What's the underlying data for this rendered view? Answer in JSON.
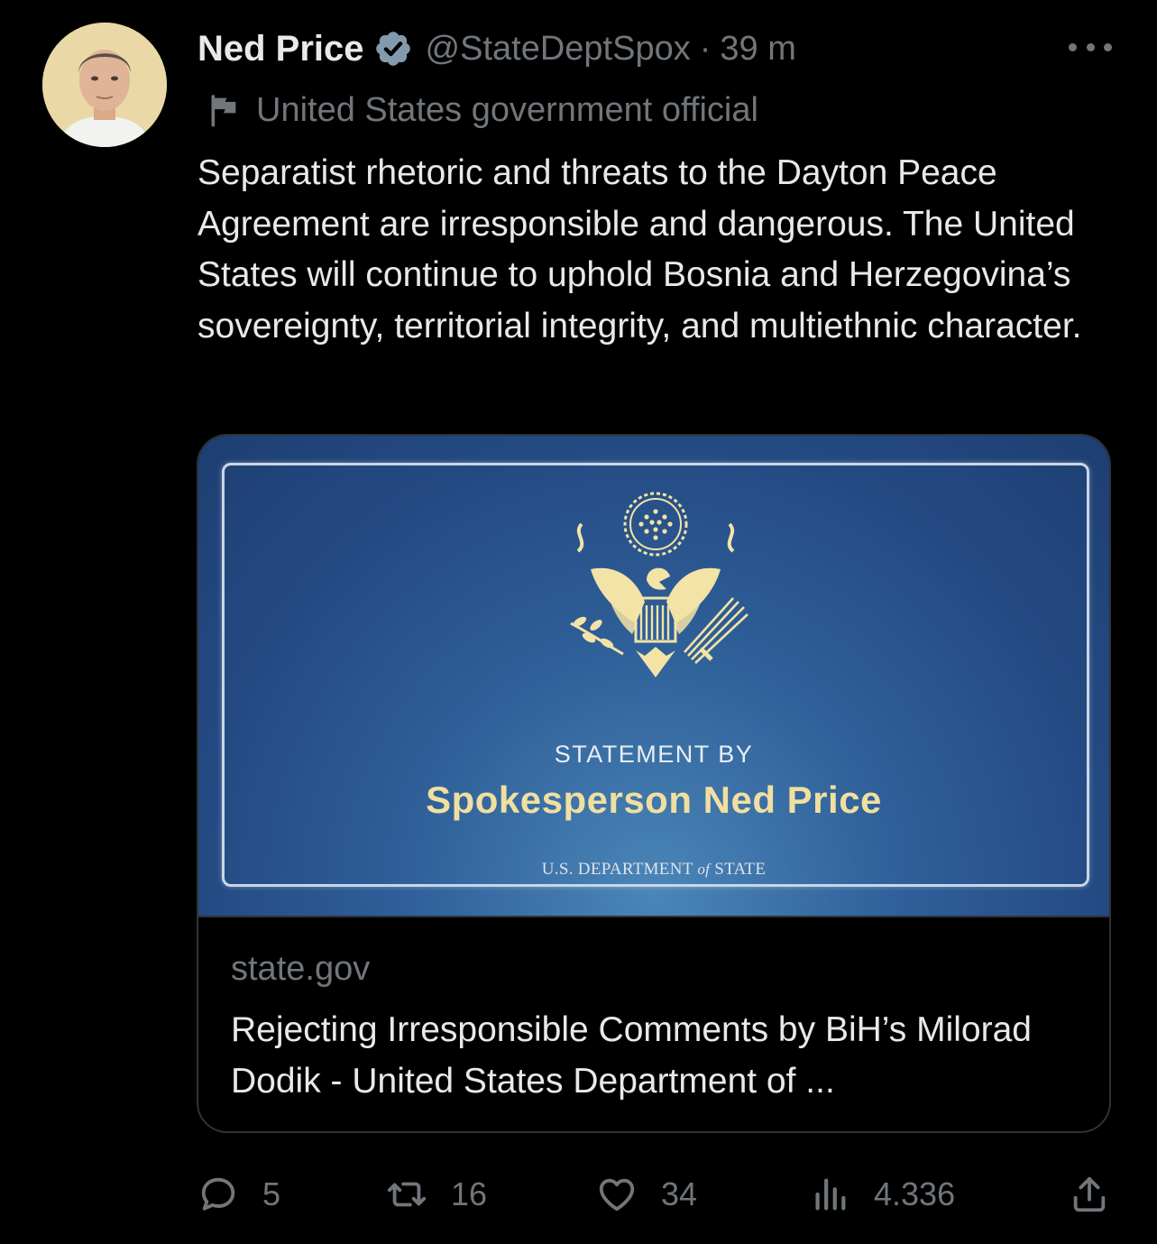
{
  "author": {
    "name": "Ned Price",
    "handle": "@StateDeptSpox",
    "separator": "·",
    "time": "39 m",
    "affiliation": "United States government official"
  },
  "tweet": {
    "text": "Separatist rhetoric and threats to the Dayton Peace Agreement are irresponsible and dangerous. The United States will continue to uphold Bosnia and Herzegovina’s sovereignty, territorial integrity, and multiethnic character."
  },
  "card": {
    "image": {
      "statement_by": "STATEMENT BY",
      "spokesperson": "Spokesperson Ned Price",
      "dept_prefix": "U.S. DEPARTMENT",
      "dept_of": "of",
      "dept_suffix": "STATE"
    },
    "domain": "state.gov",
    "title": "Rejecting Irresponsible Comments by BiH’s Milorad Dodik - United States Department of ..."
  },
  "actions": {
    "replies": "5",
    "retweets": "16",
    "likes": "34",
    "views": "4.336"
  },
  "colors": {
    "background": "#000000",
    "text": "#e7e9ea",
    "muted": "#71767b",
    "verified_badge": "#829aab",
    "card_border": "#2f3336",
    "card_blue": "#2f6099",
    "gold": "#f1dfa0"
  },
  "icons": [
    "verified-badge-icon",
    "more-icon",
    "flag-icon",
    "seal-icon",
    "reply-icon",
    "retweet-icon",
    "like-icon",
    "views-icon",
    "share-icon"
  ]
}
